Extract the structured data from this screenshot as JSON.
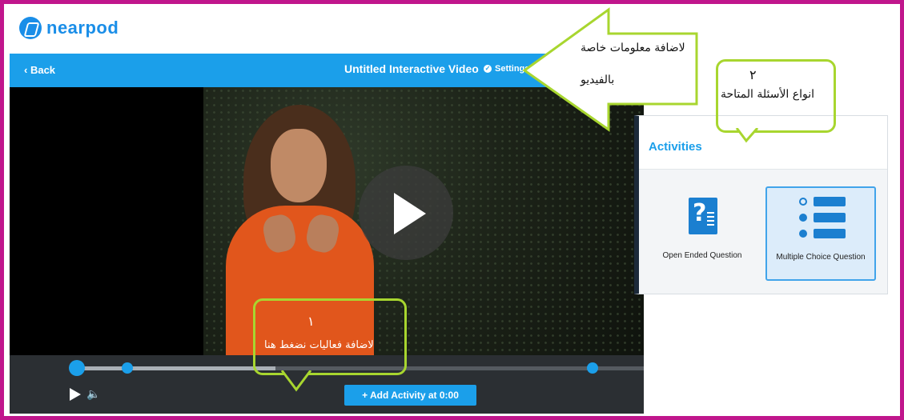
{
  "brand": {
    "name": "nearpod"
  },
  "topbar": {
    "back_label": "Back",
    "title": "Untitled Interactive Video",
    "settings_label": "Settings"
  },
  "controls": {
    "add_activity_label": "+ Add Activity at 0:00",
    "progress_fraction": 0.35
  },
  "activities": {
    "title": "Activities",
    "items": [
      {
        "label": "Open Ended Question",
        "icon": "open-question-icon"
      },
      {
        "label": "Multiple Choice Question",
        "icon": "multiple-choice-icon"
      }
    ]
  },
  "annotations": {
    "video_info": "لاضافة معلومات خاصة",
    "video_info_2": "بالفيديو",
    "question_types_num": "٢",
    "question_types": "انواع الأسئلة المتاحة",
    "add_activity_num": "١",
    "add_activity": "لاضافة فعاليات نضغط هنا"
  },
  "colors": {
    "accent": "#1b9fea",
    "frame": "#c0168c",
    "callout": "#a8d62f"
  }
}
